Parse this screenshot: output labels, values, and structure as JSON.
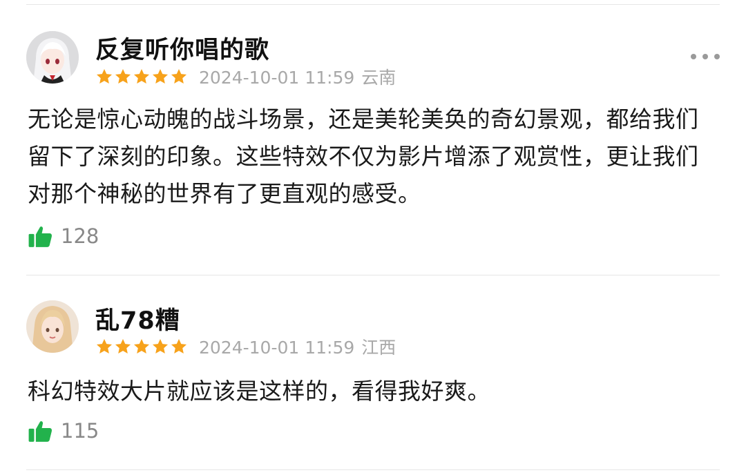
{
  "reviews": [
    {
      "username": "反复听你唱的歌",
      "rating": 5,
      "datetime": "2024-10-01 11:59",
      "location": "云南",
      "avatar_icon": "anime-girl-white-hair-avatar",
      "text": "无论是惊心动魄的战斗场景，还是美轮美奂的奇幻景观，都给我们留下了深刻的印象。这些特效不仅为影片增添了观赏性，更让我们对那个神秘的世界有了更直观的感受。",
      "likes": "128",
      "more_icon": "more-dots-icon"
    },
    {
      "username": "乱78糟",
      "rating": 5,
      "datetime": "2024-10-01 11:59",
      "location": "江西",
      "avatar_icon": "blonde-girl-avatar",
      "text": "科幻特效大片就应该是这样的，看得我好爽。",
      "likes": "115"
    }
  ],
  "colors": {
    "star": "#f7a21b",
    "like": "#22b24c",
    "meta": "#a8a8a8"
  }
}
